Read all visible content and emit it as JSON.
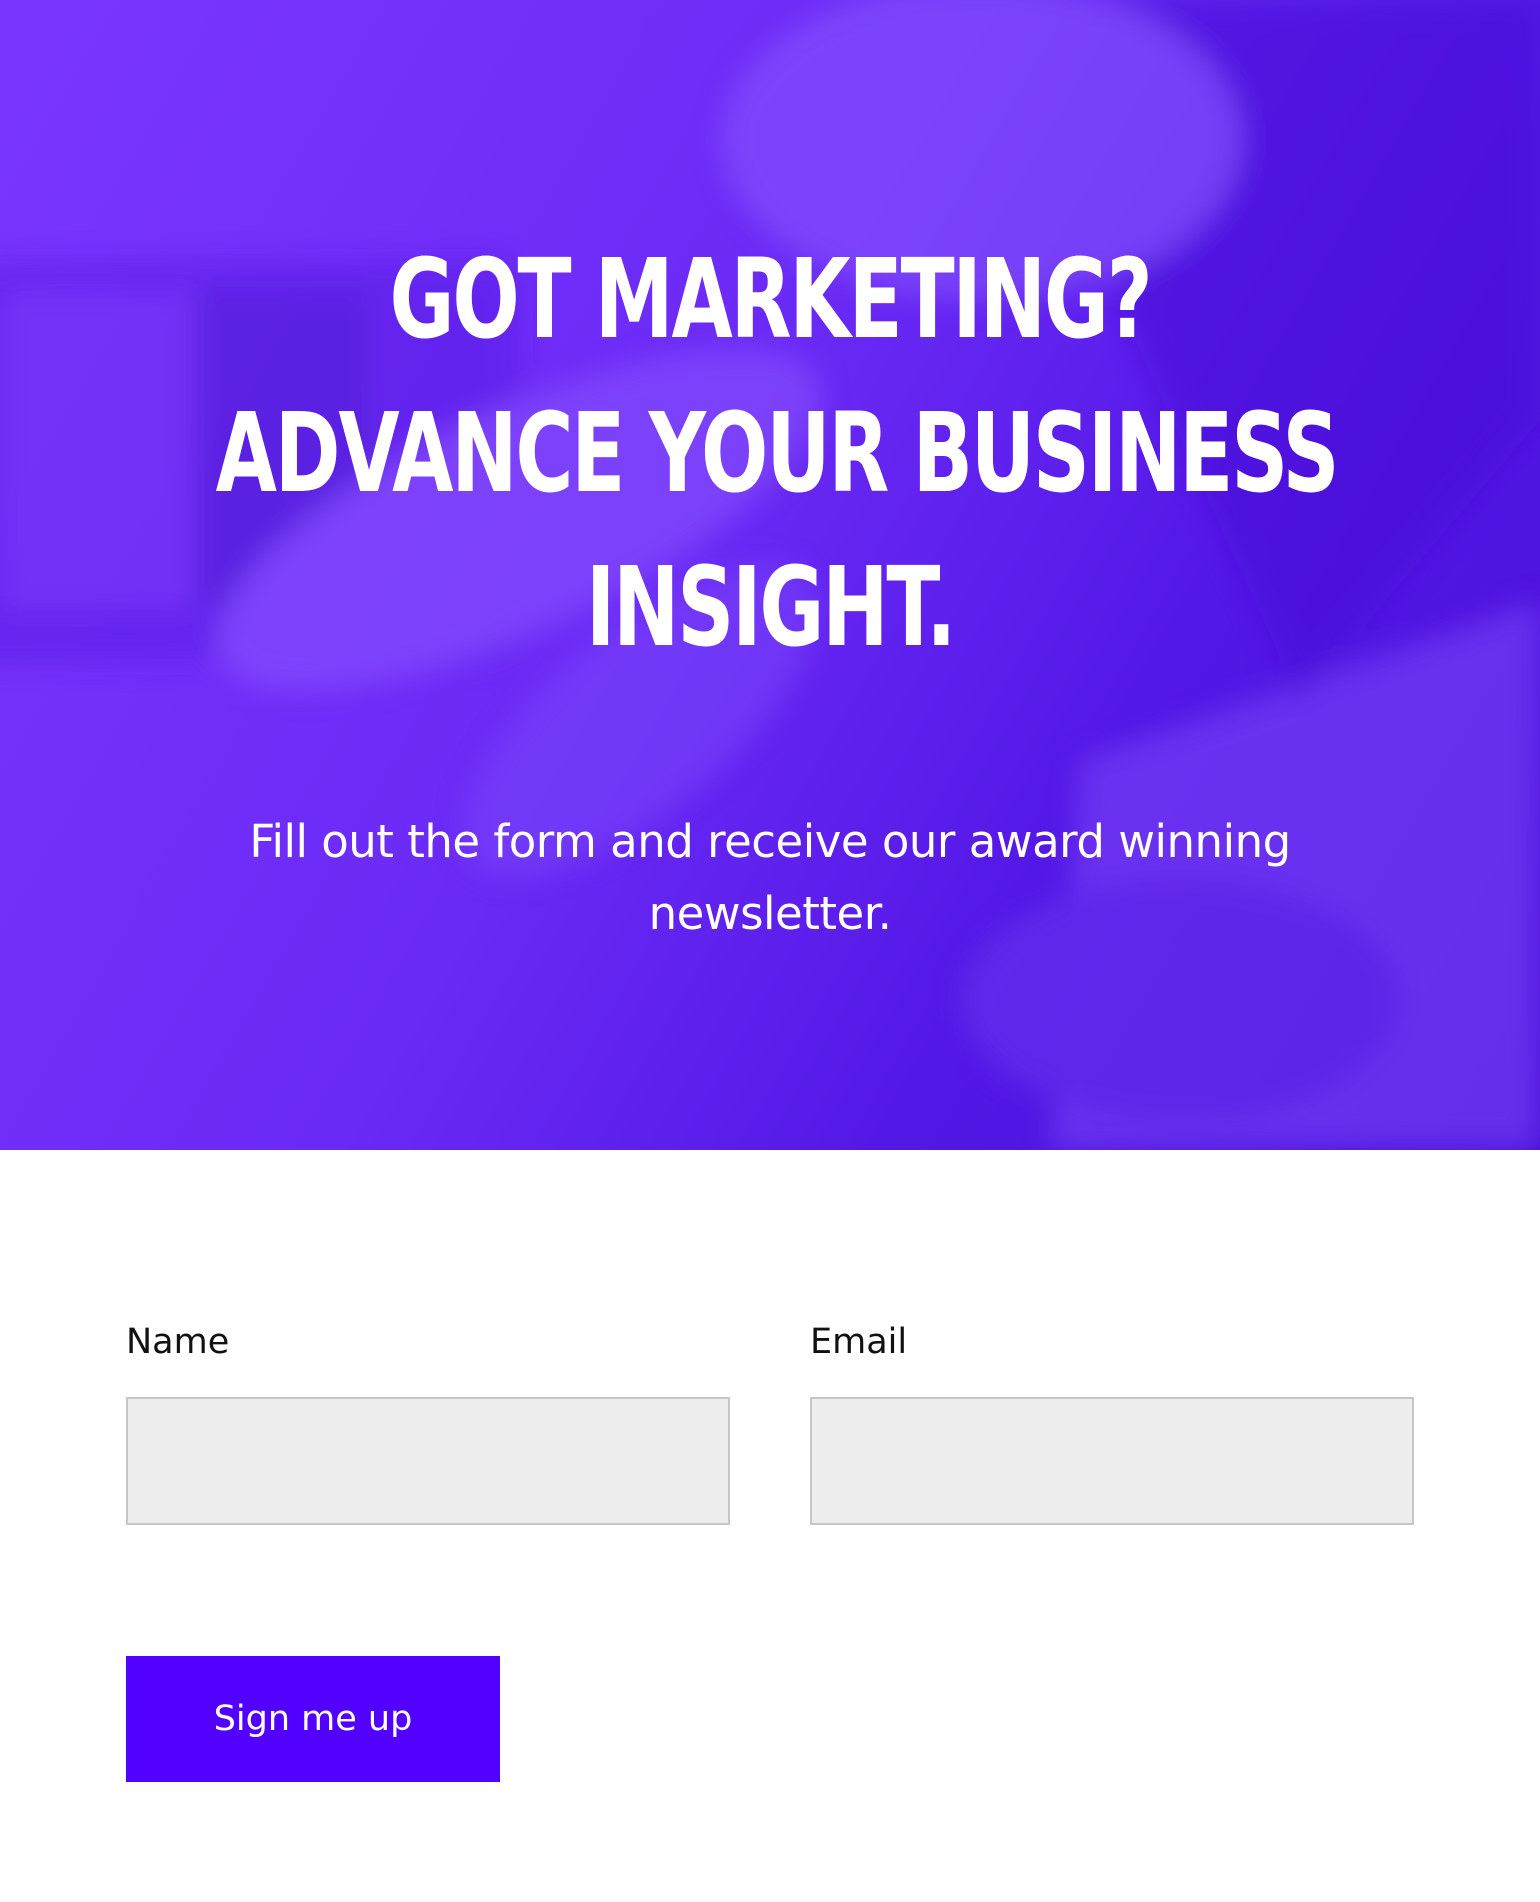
{
  "hero": {
    "title_lines": [
      "GOT MARKETING?",
      "ADVANCE YOUR BUSINESS",
      "INSIGHT."
    ],
    "subtitle": "Fill out the form and receive our award winning newsletter.",
    "overlay_color": "#6a2af5"
  },
  "form": {
    "name_label": "Name",
    "name_value": "",
    "email_label": "Email",
    "email_value": "",
    "submit_label": "Sign me up",
    "button_color": "#5200ff"
  }
}
